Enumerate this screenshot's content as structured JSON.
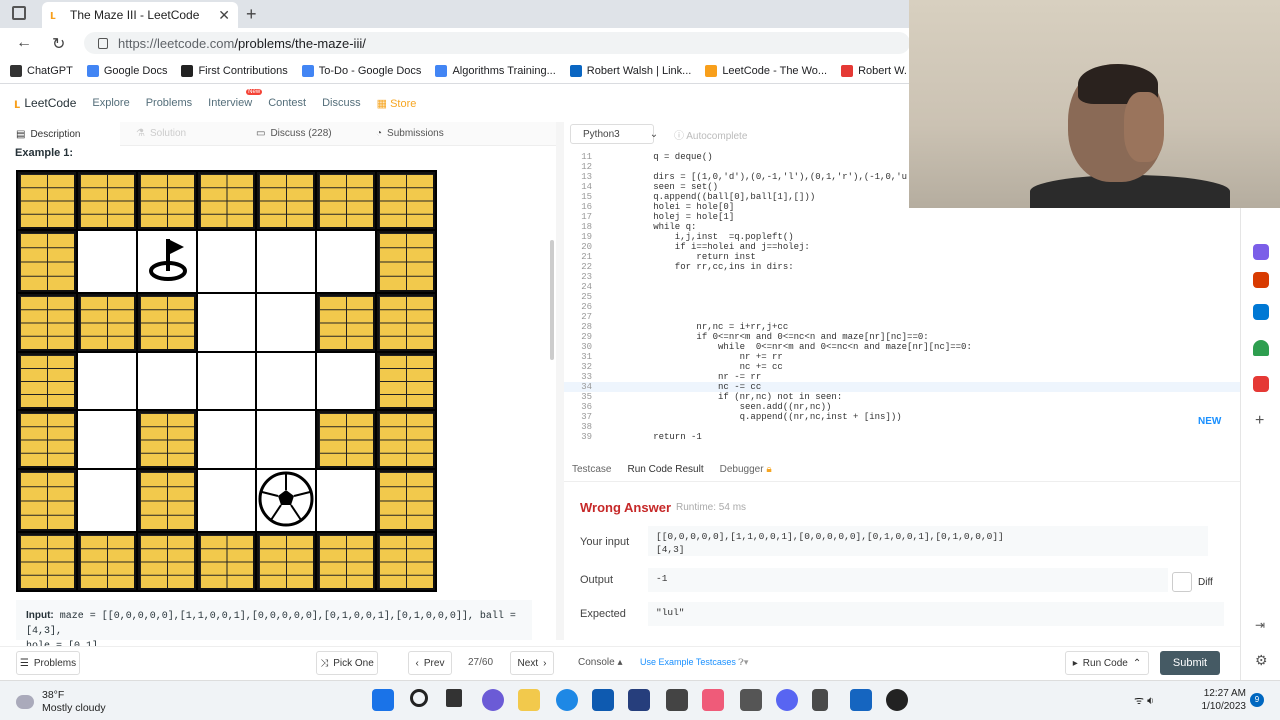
{
  "browser": {
    "tab_title": "The Maze III - LeetCode",
    "url_domain": "https://leetcode.com",
    "url_path": "/problems/the-maze-iii/",
    "bookmarks": [
      {
        "label": "ChatGPT",
        "color": "#333"
      },
      {
        "label": "Google Docs",
        "color": "#4285f4"
      },
      {
        "label": "First Contributions",
        "color": "#222"
      },
      {
        "label": "To-Do - Google Docs",
        "color": "#4285f4"
      },
      {
        "label": "Algorithms Training...",
        "color": "#4285f4"
      },
      {
        "label": "Robert Walsh | Link...",
        "color": "#0a66c2"
      },
      {
        "label": "LeetCode - The Wo...",
        "color": "#f89f1b"
      },
      {
        "label": "Robert W. - Live Co...",
        "color": "#e53935"
      }
    ]
  },
  "lcnav": {
    "logo": "LeetCode",
    "items": [
      "Explore",
      "Problems",
      "Interview",
      "Contest",
      "Discuss"
    ],
    "new_badge": "New",
    "store": "Store"
  },
  "left_tabs": {
    "description": "Description",
    "solution": "Solution",
    "discuss": "Discuss (228)",
    "submissions": "Submissions"
  },
  "problem": {
    "example_title": "Example 1:",
    "input_label": "Input:",
    "input_line1": "maze = [[0,0,0,0,0],[1,1,0,0,1],[0,0,0,0,0],[0,1,0,0,1],[0,1,0,0,0]], ball = [4,3],",
    "input_line2": "hole = [0,1]"
  },
  "maze": {
    "rows": [
      [
        1,
        1,
        1,
        1,
        1,
        1,
        1
      ],
      [
        1,
        0,
        0,
        0,
        0,
        0,
        1
      ],
      [
        1,
        1,
        1,
        0,
        0,
        1,
        1
      ],
      [
        1,
        0,
        0,
        0,
        0,
        0,
        1
      ],
      [
        1,
        0,
        1,
        0,
        0,
        1,
        1
      ],
      [
        1,
        0,
        1,
        0,
        0,
        0,
        1
      ],
      [
        1,
        1,
        1,
        1,
        1,
        1,
        1
      ]
    ],
    "hole": [
      1,
      2
    ],
    "ball": [
      5,
      4
    ]
  },
  "editor": {
    "language": "Python3",
    "autocomplete": "Autocomplete",
    "new_button": "NEW",
    "lines": [
      {
        "n": "11",
        "t": "        q = deque()"
      },
      {
        "n": "12",
        "t": ""
      },
      {
        "n": "13",
        "t": "        dirs = [(1,0,'d'),(0,-1,'l'),(0,1,'r'),(-1,0,'u')]"
      },
      {
        "n": "14",
        "t": "        seen = set()"
      },
      {
        "n": "15",
        "t": "        q.append((ball[0],ball[1],[]))"
      },
      {
        "n": "16",
        "t": "        holei = hole[0]"
      },
      {
        "n": "17",
        "t": "        holej = hole[1]"
      },
      {
        "n": "18",
        "t": "        while q:"
      },
      {
        "n": "19",
        "t": "            i,j,inst  =q.popleft()"
      },
      {
        "n": "20",
        "t": "            if i==holei and j==holej:"
      },
      {
        "n": "21",
        "t": "                return inst"
      },
      {
        "n": "22",
        "t": "            for rr,cc,ins in dirs:"
      },
      {
        "n": "23",
        "t": ""
      },
      {
        "n": "24",
        "t": ""
      },
      {
        "n": "25",
        "t": ""
      },
      {
        "n": "26",
        "t": ""
      },
      {
        "n": "27",
        "t": ""
      },
      {
        "n": "28",
        "t": "                nr,nc = i+rr,j+cc"
      },
      {
        "n": "29",
        "t": "                if 0<=nr<m and 0<=nc<n and maze[nr][nc]==0:"
      },
      {
        "n": "30",
        "t": "                    while  0<=nr<m and 0<=nc<n and maze[nr][nc]==0:"
      },
      {
        "n": "31",
        "t": "                        nr += rr"
      },
      {
        "n": "32",
        "t": "                        nc += cc"
      },
      {
        "n": "33",
        "t": "                    nr -= rr"
      },
      {
        "n": "34",
        "t": "                    nc -= cc"
      },
      {
        "n": "35",
        "t": "                    if (nr,nc) not in seen:"
      },
      {
        "n": "36",
        "t": "                        seen.add((nr,nc))"
      },
      {
        "n": "37",
        "t": "                        q.append((nr,nc,inst + [ins]))"
      },
      {
        "n": "38",
        "t": ""
      },
      {
        "n": "39",
        "t": "        return -1"
      }
    ]
  },
  "bottom_tabs": {
    "testcase": "Testcase",
    "run_result": "Run Code Result",
    "debugger": "Debugger"
  },
  "result": {
    "status": "Wrong Answer",
    "runtime": "Runtime: 54 ms",
    "your_input_label": "Your input",
    "your_input_line1": "[[0,0,0,0,0],[1,1,0,0,1],[0,0,0,0,0],[0,1,0,0,1],[0,1,0,0,0]]",
    "your_input_line2": "[4,3]",
    "output_label": "Output",
    "output": "-1",
    "expected_label": "Expected",
    "expected": "\"lul\"",
    "diff": "Diff"
  },
  "footer": {
    "problems": "Problems",
    "pick_one": "Pick One",
    "prev": "Prev",
    "page": "27/60",
    "next": "Next",
    "console": "Console",
    "use_example": "Use Example Testcases",
    "run_code": "Run Code",
    "submit": "Submit"
  },
  "taskbar": {
    "temp": "38°F",
    "weather": "Mostly cloudy",
    "time": "12:27 AM",
    "date": "1/10/2023",
    "notif": "9"
  }
}
